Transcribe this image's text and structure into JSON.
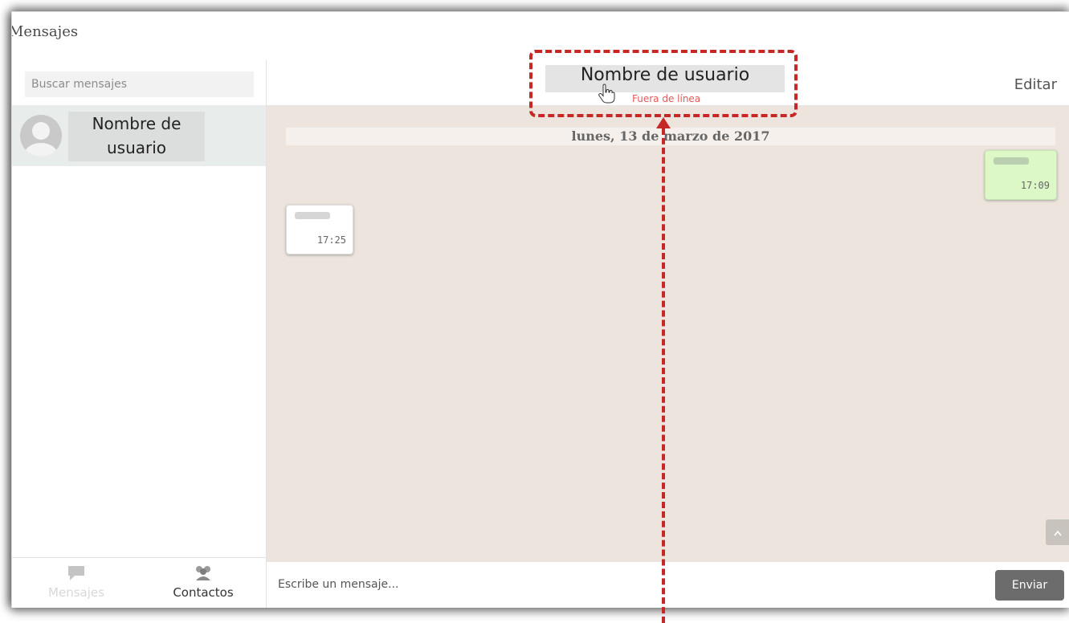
{
  "app": {
    "title": "Mensajes"
  },
  "sidebar": {
    "search_placeholder": "Buscar mensajes",
    "conversations": [
      {
        "name": "Nombre de usuario"
      }
    ],
    "nav": [
      {
        "label": "Mensajes",
        "icon": "chat-bubble-icon",
        "active": false
      },
      {
        "label": "Contactos",
        "icon": "contacts-icon",
        "active": true
      }
    ]
  },
  "chat": {
    "header": {
      "name": "Nombre de usuario",
      "status": "Fuera de línea",
      "edit_label": "Editar"
    },
    "date_separator": "lunes, 13 de marzo de 2017",
    "messages": [
      {
        "direction": "outgoing",
        "time": "17:09"
      },
      {
        "direction": "incoming",
        "time": "17:25"
      }
    ],
    "composer": {
      "placeholder": "Escribe un mensaje...",
      "send_label": "Enviar"
    }
  },
  "colors": {
    "annotation": "#c62828",
    "chat_background": "#ece4dd",
    "outgoing_bubble": "#dcf8c6",
    "status_offline": "#e05a5a"
  }
}
